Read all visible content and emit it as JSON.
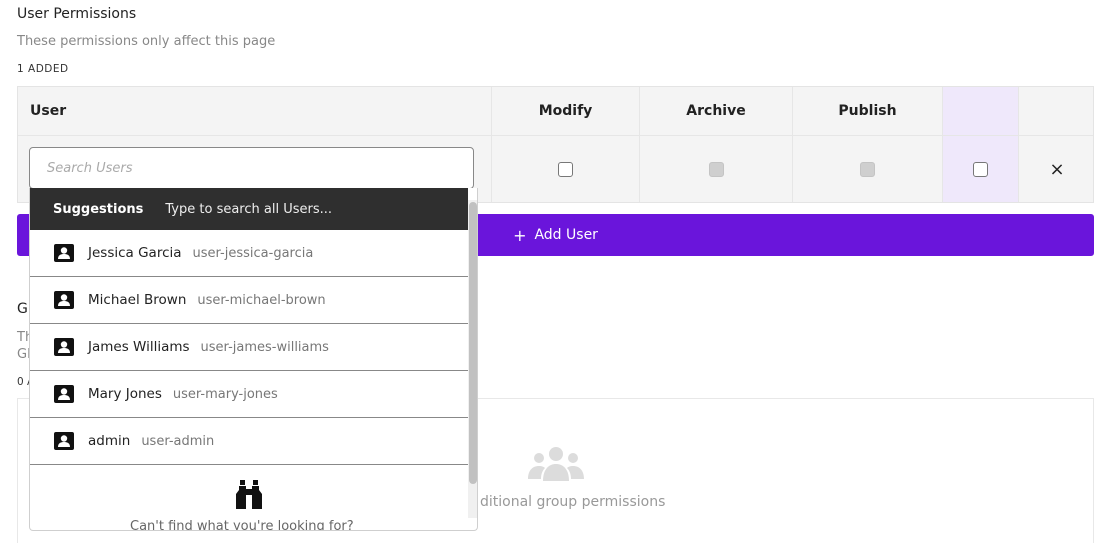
{
  "user_permissions": {
    "title": "User Permissions",
    "subtitle": "These permissions only affect this page",
    "count": "1 ADDED",
    "columns": {
      "user": "User",
      "modify": "Modify",
      "archive": "Archive",
      "publish": "Publish"
    },
    "remove_icon": "×",
    "add_button": {
      "icon": "+",
      "label": "Add User"
    }
  },
  "search": {
    "placeholder": "Search Users"
  },
  "suggestions": {
    "header_label": "Suggestions",
    "header_hint": "Type to search all Users...",
    "items": [
      {
        "name": "Jessica Garcia",
        "slug": "user-jessica-garcia"
      },
      {
        "name": "Michael Brown",
        "slug": "user-michael-brown"
      },
      {
        "name": "James Williams",
        "slug": "user-james-williams"
      },
      {
        "name": "Mary Jones",
        "slug": "user-mary-jones"
      },
      {
        "name": "admin",
        "slug": "user-admin"
      }
    ],
    "footer_text": "Can't find what you're looking for?"
  },
  "group_permissions": {
    "title_fragment": "G",
    "subtitle_fragment_1": "Th",
    "subtitle_fragment_2": "Gl",
    "count_fragment": "0 A",
    "empty_message": "ditional group permissions"
  },
  "colors": {
    "accent": "#6a15db",
    "dropdown_header": "#2f2f2f",
    "highlight_column": "#efe8fb"
  },
  "icons": {
    "user_item": "user-contact-icon",
    "footer": "binoculars-icon",
    "empty_groups": "group-icon",
    "remove": "close-icon",
    "add": "plus-icon"
  }
}
